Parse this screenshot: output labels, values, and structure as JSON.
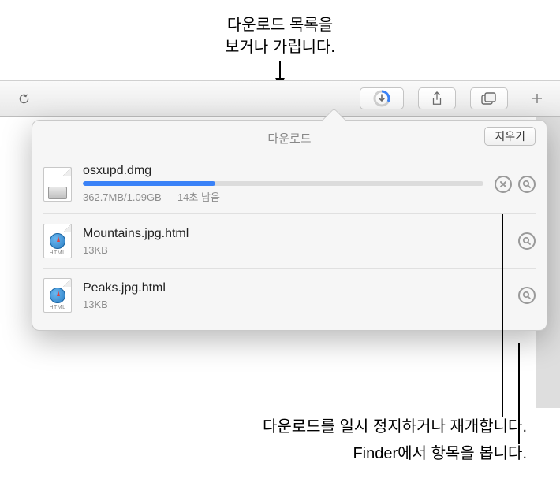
{
  "callouts": {
    "top_line1": "다운로드 목록을",
    "top_line2": "보거나 가립니다.",
    "bottom1": "다운로드를 일시 정지하거나 재개합니다.",
    "bottom2": "Finder에서 항목을 봅니다."
  },
  "popover": {
    "title": "다운로드",
    "clear_label": "지우기"
  },
  "downloads": [
    {
      "name": "osxupd.dmg",
      "meta": "362.7MB/1.09GB — 14초 남음",
      "progress_percent": 33,
      "icon_type": "dmg",
      "in_progress": true
    },
    {
      "name": "Mountains.jpg.html",
      "meta": "13KB",
      "icon_type": "html",
      "in_progress": false
    },
    {
      "name": "Peaks.jpg.html",
      "meta": "13KB",
      "icon_type": "html",
      "in_progress": false
    }
  ]
}
